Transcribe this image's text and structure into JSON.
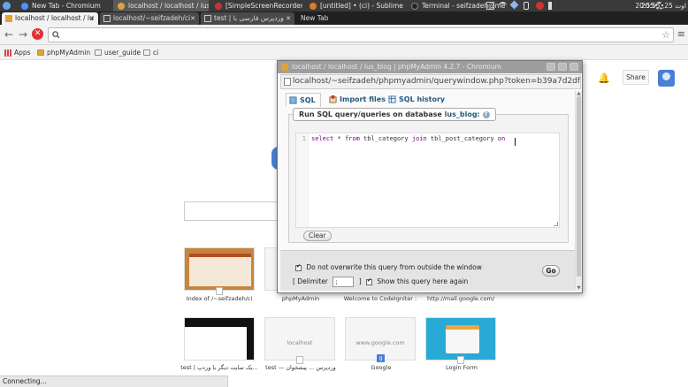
{
  "taskbar": {
    "items": [
      {
        "label": "New Tab - Chromium"
      },
      {
        "label": "localhost / localhost / lus..."
      },
      {
        "label": "[SimpleScreenRecorder]"
      },
      {
        "label": "[untitled] • (ci) - Sublime T..."
      },
      {
        "label": "Terminal - seifzadeh@me..."
      }
    ],
    "time": "20:55",
    "datetime": "20:55 ,25 اوت"
  },
  "browser_tabs": [
    {
      "label": "localhost / localhost / lu"
    },
    {
      "label": "localhost/~seifzadeh/ci"
    },
    {
      "label": "test | وردپرس فارسی با"
    }
  ],
  "new_tab_label": "New Tab",
  "bookmarks": [
    {
      "label": "Apps"
    },
    {
      "label": "phpMyAdmin"
    },
    {
      "label": "user_guide"
    },
    {
      "label": "ci"
    }
  ],
  "ntp": {
    "share_label": "Share",
    "tiles_row1": [
      {
        "label": "Index of /~seifzadeh/ci"
      },
      {
        "label": "phpMyAdmin"
      },
      {
        "label": "Welcome to CodeIgniter :"
      },
      {
        "label": "http://mail.google.com/"
      }
    ],
    "tiles_row2": [
      {
        "label": "test | یک سایت دیگر با وردپ...",
        "text": ""
      },
      {
        "label": "test — وردپرس ... پیشخوان",
        "text": "localhost"
      },
      {
        "label": "Google",
        "text": "www.google.com"
      },
      {
        "label": "Login Form",
        "text": ""
      }
    ]
  },
  "status": "Connecting...",
  "popup": {
    "title": "localhost / localhost / lus_blog | phpMyAdmin 4.2.7 - Chromium",
    "url": "localhost/~seifzadeh/phpmyadmin/querywindow.php?token=b39a7d2df1e0ba7f",
    "tabs": [
      {
        "label": "SQL"
      },
      {
        "label": "Import files"
      },
      {
        "label": "SQL history"
      }
    ],
    "legend_prefix": "Run SQL query/queries on database",
    "database": "lus_blog:",
    "line_number": "1",
    "code": {
      "kw1": "select",
      "t1": " * ",
      "kw2": "from",
      "t2": " tbl_category ",
      "kw3": "join",
      "t3": " tbl_post_category ",
      "kw4": "on"
    },
    "clear_label": "Clear",
    "no_overwrite_label": "Do not overwrite this query from outside the window",
    "delimiter_open": "[ Delimiter",
    "delimiter_value": ";",
    "delimiter_close": "]",
    "show_again_label": "Show this query here again",
    "go_label": "Go"
  }
}
